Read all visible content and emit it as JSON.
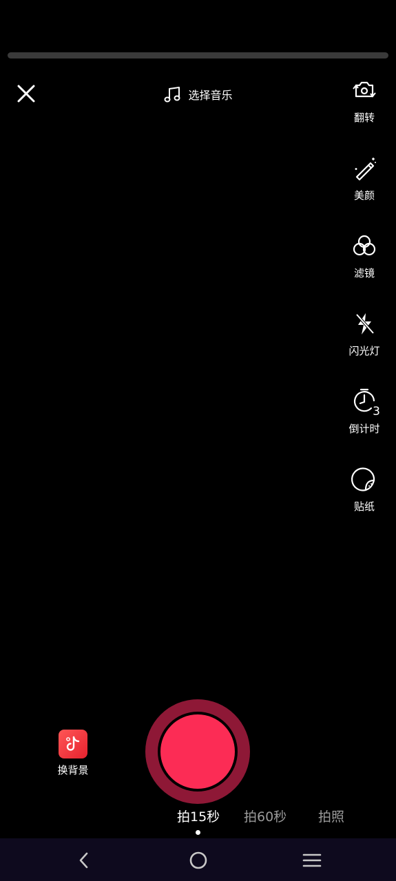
{
  "recording": {
    "progress_percent": 0
  },
  "header": {
    "close_icon": "close-icon",
    "music": {
      "icon": "music-note-icon",
      "label": "选择音乐"
    }
  },
  "side_tools": [
    {
      "id": "flip",
      "icon": "camera-flip-icon",
      "label": "翻转"
    },
    {
      "id": "beauty",
      "icon": "magic-wand-icon",
      "label": "美颜"
    },
    {
      "id": "filter",
      "icon": "filter-circles-icon",
      "label": "滤镜"
    },
    {
      "id": "flash",
      "icon": "flash-off-icon",
      "label": "闪光灯"
    },
    {
      "id": "countdown",
      "icon": "timer-icon",
      "label": "倒计时",
      "badge": "3"
    },
    {
      "id": "sticker",
      "icon": "sticker-icon",
      "label": "贴纸"
    }
  ],
  "background_swap": {
    "icon": "tiktok-logo-icon",
    "label": "换背景"
  },
  "record_button": {
    "color": "#fc2c55",
    "ring_color": "#8e1836"
  },
  "capture_modes": [
    {
      "label": "拍15秒",
      "active": true
    },
    {
      "label": "拍60秒",
      "active": false
    },
    {
      "label": "拍照",
      "active": false
    }
  ],
  "navbar": {
    "back_icon": "back-icon",
    "home_icon": "home-icon",
    "menu_icon": "menu-icon"
  }
}
